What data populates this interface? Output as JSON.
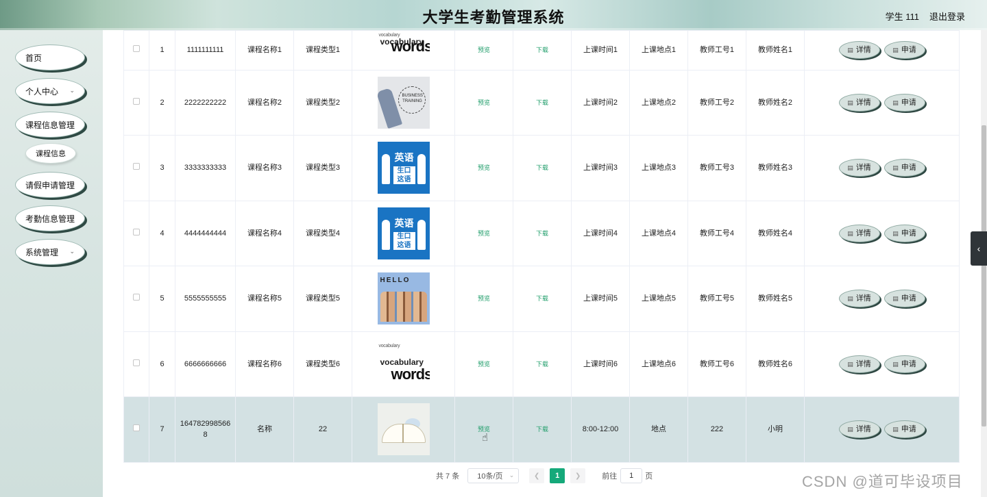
{
  "header": {
    "title": "大学生考勤管理系统",
    "user": "学生 111",
    "logout": "退出登录"
  },
  "sidebar": {
    "items": [
      {
        "label": "首页",
        "has_arrow": false
      },
      {
        "label": "个人中心",
        "has_arrow": true
      },
      {
        "label": "课程信息管理",
        "has_arrow": false
      },
      {
        "label": "课程信息",
        "is_sub": true
      },
      {
        "label": "请假申请管理",
        "has_arrow": false
      },
      {
        "label": "考勤信息管理",
        "has_arrow": false
      },
      {
        "label": "系统管理",
        "has_arrow": true
      }
    ]
  },
  "table": {
    "preview_label": "预览",
    "download_label": "下载",
    "detail_label": "详情",
    "apply_label": "申请",
    "rows": [
      {
        "index": "1",
        "code": "1111111111",
        "name": "课程名称1",
        "type": "课程类型1",
        "thumb": "words",
        "time": "上课时间1",
        "place": "上课地点1",
        "teacher_no": "教师工号1",
        "teacher_name": "教师姓名1"
      },
      {
        "index": "2",
        "code": "2222222222",
        "name": "课程名称2",
        "type": "课程类型2",
        "thumb": "biz",
        "time": "上课时间2",
        "place": "上课地点2",
        "teacher_no": "教师工号2",
        "teacher_name": "教师姓名2"
      },
      {
        "index": "3",
        "code": "3333333333",
        "name": "课程名称3",
        "type": "课程类型3",
        "thumb": "eng",
        "time": "上课时间3",
        "place": "上课地点3",
        "teacher_no": "教师工号3",
        "teacher_name": "教师姓名3"
      },
      {
        "index": "4",
        "code": "4444444444",
        "name": "课程名称4",
        "type": "课程类型4",
        "thumb": "eng",
        "time": "上课时间4",
        "place": "上课地点4",
        "teacher_no": "教师工号4",
        "teacher_name": "教师姓名4"
      },
      {
        "index": "5",
        "code": "5555555555",
        "name": "课程名称5",
        "type": "课程类型5",
        "thumb": "hello",
        "time": "上课时间5",
        "place": "上课地点5",
        "teacher_no": "教师工号5",
        "teacher_name": "教师姓名5"
      },
      {
        "index": "6",
        "code": "6666666666",
        "name": "课程名称6",
        "type": "课程类型6",
        "thumb": "words",
        "time": "上课时间6",
        "place": "上课地点6",
        "teacher_no": "教师工号6",
        "teacher_name": "教师姓名6"
      },
      {
        "index": "7",
        "code": "1647829985668",
        "name": "名称",
        "type": "22",
        "thumb": "book",
        "time": "8:00-12:00",
        "place": "地点",
        "teacher_no": "222",
        "teacher_name": "小明"
      }
    ]
  },
  "thumb_text": {
    "words_small": "vocabulary",
    "words_big": "words",
    "biz": "BUSINESS TRAINING",
    "eng_top": "英语",
    "eng_bottom": "生口 这语",
    "hello": "HELLO"
  },
  "pager": {
    "total": "共 7 条",
    "page_size": "10条/页",
    "current": "1",
    "goto_label": "前往",
    "goto_value": "1",
    "page_unit": "页"
  },
  "watermark": "CSDN @道可毕设项目",
  "colors": {
    "accent": "#15a97a",
    "link": "#1f9d6a",
    "highlight_row": "#d3e1e3"
  }
}
